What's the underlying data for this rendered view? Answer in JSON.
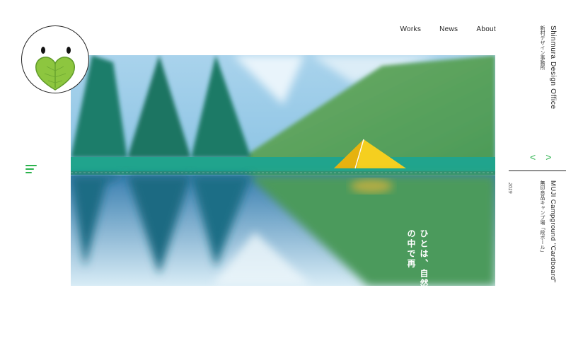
{
  "logo": {
    "alt": "leaf face logo",
    "icon": "leaf-icon"
  },
  "nav": {
    "items": [
      {
        "label": "Works"
      },
      {
        "label": "News"
      },
      {
        "label": "About"
      }
    ]
  },
  "hero": {
    "copy": "ひとは、自然の中で再"
  },
  "brand": {
    "name_en": "Shinmura Design Office",
    "name_jp": "新村デザイン事務所"
  },
  "slider": {
    "prev": "<",
    "next": ">"
  },
  "project": {
    "title_en": "MUJI Campground \"Cardboard\"",
    "title_jp": "無印良品キャンプ場「段ボール」",
    "year": "2019"
  },
  "colors": {
    "accent": "#2bb24c",
    "hero_green": "#6fad6a",
    "sky_blue": "#9bcbe6"
  }
}
